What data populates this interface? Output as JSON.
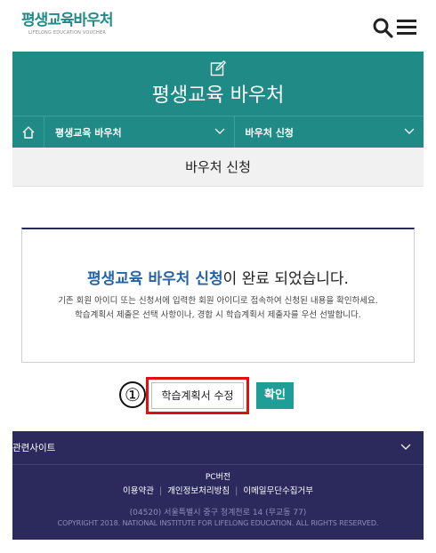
{
  "header": {
    "logo_text": "평생교육바우처",
    "logo_subtext": "LIFELONG EDUCATION VOUCHER",
    "search_icon": "search-icon",
    "menu_icon": "hamburger-menu-icon"
  },
  "hero": {
    "icon": "edit-icon",
    "title": "평생교육 바우처"
  },
  "breadcrumb": {
    "home_icon": "home-icon",
    "items": [
      {
        "label": "평생교육 바우처"
      },
      {
        "label": "바우처 신청"
      }
    ]
  },
  "page": {
    "heading": "바우처 신청"
  },
  "message": {
    "title_accent": "평생교육 바우처 신청",
    "title_rest": "이 완료 되었습니다.",
    "line1": "기존 회원 아이디 또는 신청서에 입력한 회원 아이디로 접속하여 신청된 내용을 확인하세요.",
    "line2": "학습계획서 제출은 선택 사항이나, 경합 시 학습계획서 제출자를 우선 선발합니다."
  },
  "actions": {
    "marker": "①",
    "edit_label": "학습계획서 수정",
    "ok_label": "확인"
  },
  "footer": {
    "related_label": "관련사이트",
    "pc_label": "PC버전",
    "links": [
      "이용약관",
      "개인정보처리방침",
      "이메일무단수집거부"
    ],
    "address": "(04520) 서울특별시 중구 청계천로 14 (무교동 77)",
    "copyright": "COPYRIGHT 2018. NATIONAL INSTITUTE FOR LIFELONG EDUCATION. ALL RIGHTS RESERVED."
  },
  "colors": {
    "brand_teal": "#1f8a86",
    "footer_navy": "#2c2a5c",
    "accent_blue": "#2563a8",
    "highlight_red": "#e01010",
    "ok_button": "#1f9e97"
  }
}
